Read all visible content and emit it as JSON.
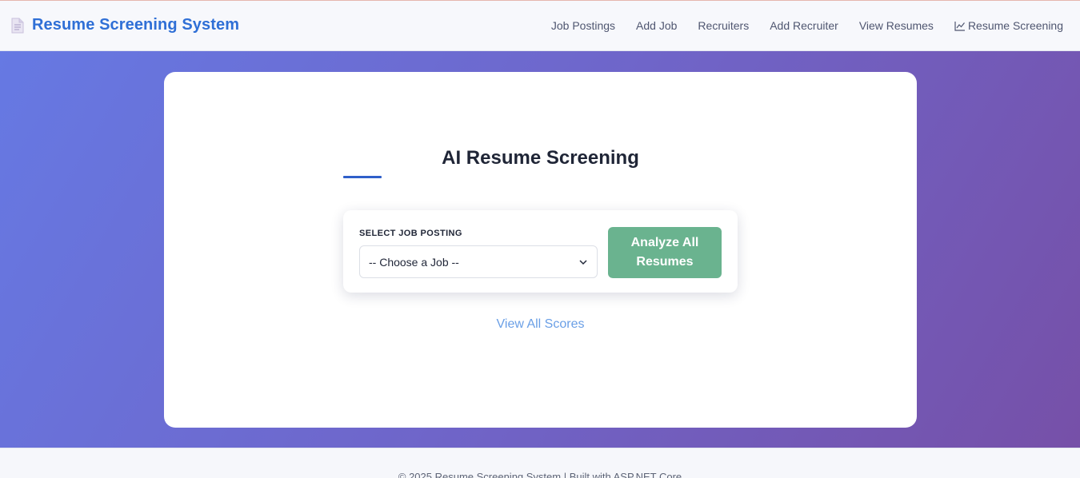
{
  "brand": {
    "icon": "document-icon",
    "title": "Resume Screening System"
  },
  "nav": {
    "items": [
      {
        "label": "Job Postings"
      },
      {
        "label": "Add Job"
      },
      {
        "label": "Recruiters"
      },
      {
        "label": "Add Recruiter"
      },
      {
        "label": "View Resumes"
      },
      {
        "label": "Resume Screening",
        "icon": "chart-line-icon"
      }
    ]
  },
  "main": {
    "title": "AI Resume Screening",
    "form": {
      "label": "SELECT JOB POSTING",
      "select_value": "-- Choose a Job --",
      "analyze_label": "Analyze All Resumes"
    },
    "view_scores_label": "View All Scores"
  },
  "footer": {
    "text": "© 2025 Resume Screening System | Built with ASP.NET Core"
  },
  "colors": {
    "brand": "#2f6fd6",
    "gradient_start": "#6679e3",
    "gradient_end": "#7650a8",
    "button": "#6ab38f",
    "link": "#6a9fe6"
  }
}
